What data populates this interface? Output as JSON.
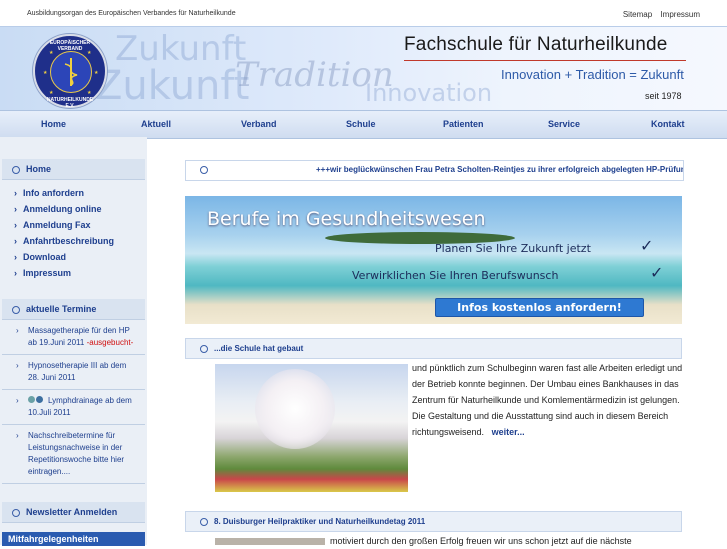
{
  "topbar": {
    "tagline": "Ausbildungsorgan des Europäischen Verbandes für Naturheilkunde",
    "links": [
      "Sitemap",
      "Impressum"
    ]
  },
  "header": {
    "title": "Fachschule für Naturheilkunde",
    "motto": "Innovation + Tradition = Zukunft",
    "since": "seit 1978",
    "watermark": {
      "w1": "Zukunft",
      "w2": "Zukunft",
      "w3": "Tradition",
      "w4": "Innovation"
    },
    "logo": {
      "top": "EUROPÄISCHER VERBAND",
      "bottom": "NATURHEILKUNDE E.V."
    }
  },
  "nav": [
    "Home",
    "Aktuell",
    "Verband",
    "Schule",
    "Patienten",
    "Service",
    "Kontakt"
  ],
  "sidebar": {
    "home": "Home",
    "menu": [
      "Info anfordern",
      "Anmeldung online",
      "Anmeldung Fax",
      "Anfahrtbeschreibung",
      "Download",
      "Impressum"
    ],
    "termine_title": "aktuelle Termine",
    "termine": [
      {
        "text": "Massagetherapie für den HP ab 19.Juni 2011",
        "note": "-ausgebucht-"
      },
      {
        "text": "Hypnosetherapie III ab dem 28. Juni 2011",
        "note": ""
      },
      {
        "text": "Lymphdrainage ab dem 10.Juli 2011",
        "note": ""
      },
      {
        "text": "Nachschreibetermine für Leistungsnachweise in der Repetitionswoche bitte hier eintragen....",
        "note": ""
      }
    ],
    "newsletter": "Newsletter Anmelden",
    "mitfahr": "Mitfahrgelegenheiten"
  },
  "ticker": {
    "text": "+++wir beglückwünschen Frau Petra Scholten-Reintjes zu ihrer erfolgreich abgelegten HP-Prüfung"
  },
  "banner": {
    "headline": "Berufe im Gesundheitswesen",
    "line1": "Planen Sie Ihre Zukunft jetzt",
    "line2": "Verwirklichen Sie Ihren Berufswunsch",
    "check": "✓",
    "button": "Infos kostenlos anfordern!"
  },
  "articles": [
    {
      "title": "...die Schule hat gebaut",
      "text": "und pünktlich zum Schulbeginn waren fast alle Arbeiten erledigt und der Betrieb konnte  beginnen. Der Umbau eines Bankhauses in das Zentrum für Naturheilkunde und Komlementärmedizin ist gelungen. Die Gestaltung und die Ausstattung sind auch in diesem Bereich richtungsweisend.",
      "more": "weiter..."
    },
    {
      "title": "8. Duisburger Heilpraktiker und Naturheilkundetag 2011",
      "text": "motiviert durch den großen Erfolg  freuen wir uns schon jetzt auf die nächste"
    }
  ],
  "colors": {
    "nav_text": "#1e3f8e",
    "accent_red": "#c0392b",
    "motto_blue": "#2d5aa8",
    "button_blue": "#2e79d2"
  }
}
